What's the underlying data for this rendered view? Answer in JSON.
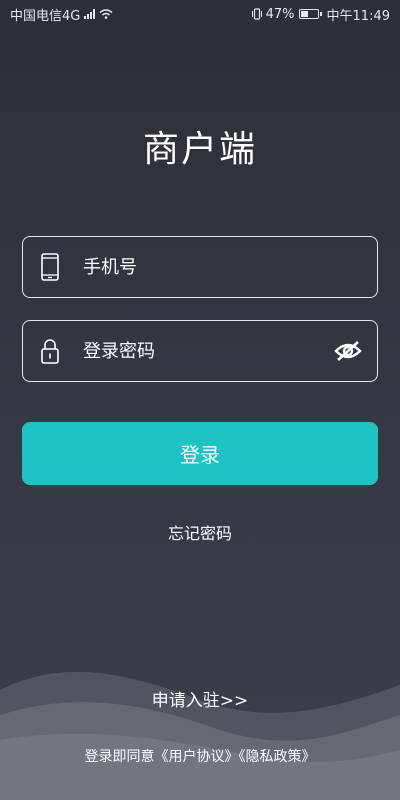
{
  "status_bar": {
    "carrier": "中国电信4G",
    "network_badge": "4G",
    "battery": "47%",
    "battery_level": 0.47,
    "time": "中午11:49"
  },
  "app": {
    "title": "商户端"
  },
  "form": {
    "phone_placeholder": "手机号",
    "password_placeholder": "登录密码",
    "login_label": "登录",
    "forgot_label": "忘记密码"
  },
  "footer": {
    "register_label": "申请入驻>>",
    "agreement_prefix": "登录即同意",
    "user_agreement": "《用户协议》",
    "privacy_policy": "《隐私政策》"
  },
  "colors": {
    "accent": "#1ec3c6",
    "background": "#2f323a"
  }
}
